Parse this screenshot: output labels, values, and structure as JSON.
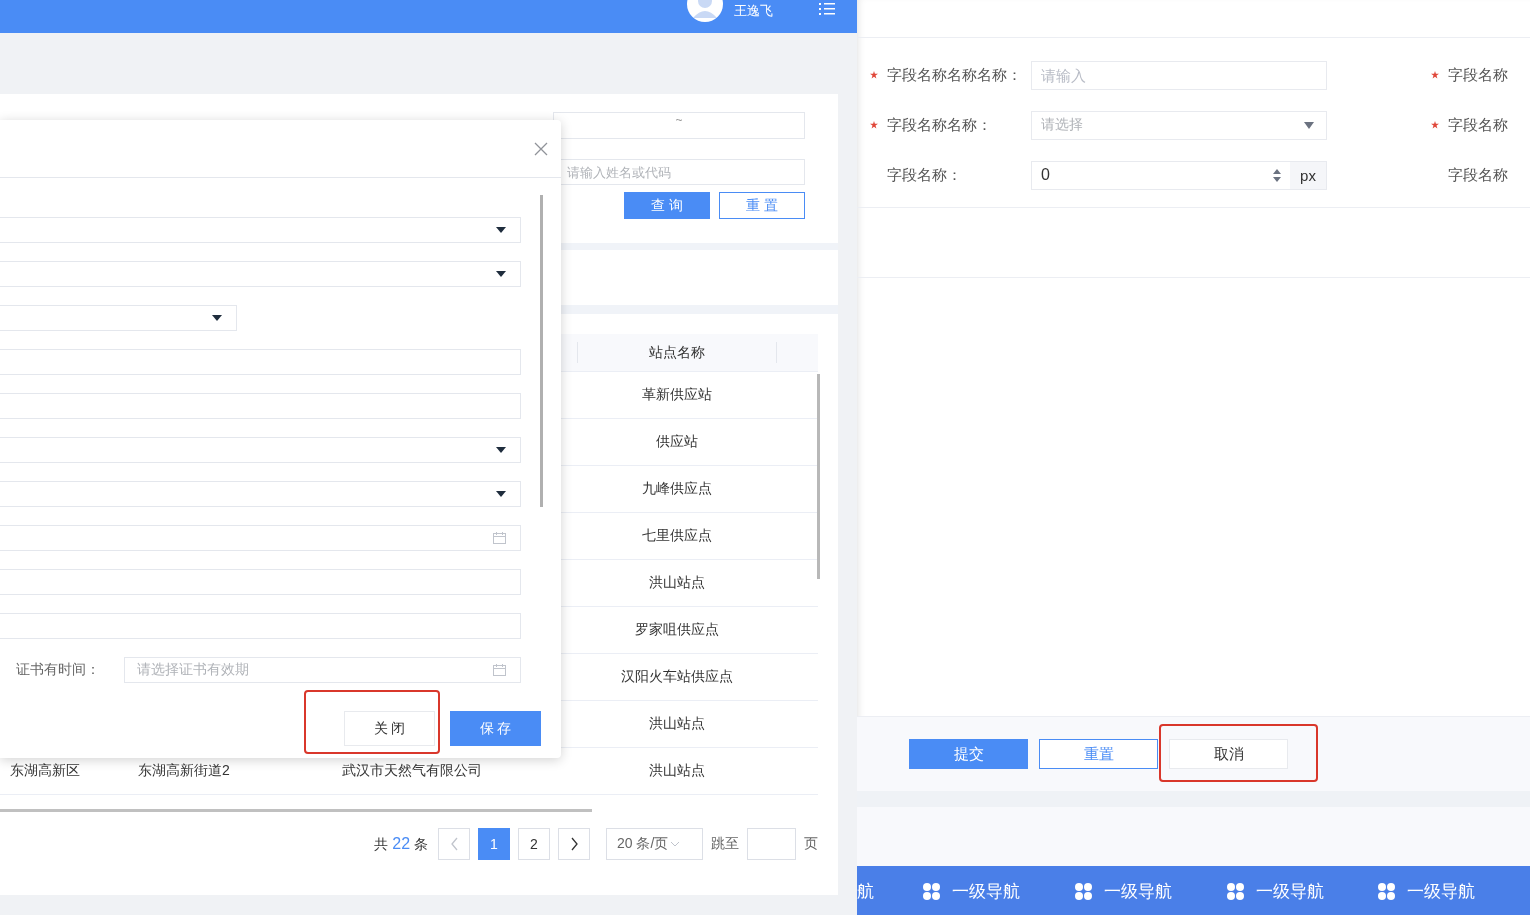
{
  "header": {
    "user_name": "王逸飞"
  },
  "filters": {
    "date_range": {
      "separator": "~"
    },
    "name_code_field": {
      "placeholder": "请输入姓名或代码"
    },
    "buttons": [
      {
        "label": "查 询",
        "kind": "primary"
      },
      {
        "label": "重 置",
        "kind": "outline"
      }
    ]
  },
  "table": {
    "columns": [
      "站点名称"
    ],
    "rows": [
      {
        "station": "革新供应站"
      },
      {
        "station": "供应站"
      },
      {
        "station": "九峰供应点"
      },
      {
        "station": "七里供应点"
      },
      {
        "station": "洪山站点"
      },
      {
        "station": "罗家咀供应点"
      },
      {
        "station": "汉阳火车站供应点"
      },
      {
        "station": "洪山站点"
      },
      {
        "district": "东湖高新区",
        "street": "东湖高新街道2",
        "company": "武汉市天然气有限公司",
        "station": "洪山站点"
      }
    ]
  },
  "pagination": {
    "total_prefix": "共",
    "total": "22",
    "total_suffix": "条",
    "pages": [
      {
        "label": "1",
        "selected": true
      },
      {
        "label": "2",
        "selected": false
      }
    ],
    "page_size": "20 条/页",
    "jump_label": "跳至",
    "page_suffix": "页"
  },
  "dialog": {
    "fields": [
      {
        "kind": "select"
      },
      {
        "kind": "select"
      },
      {
        "kind": "short-select"
      },
      {
        "kind": "input"
      },
      {
        "kind": "input"
      },
      {
        "kind": "select"
      },
      {
        "kind": "select"
      },
      {
        "kind": "date"
      },
      {
        "kind": "input"
      },
      {
        "kind": "input"
      }
    ],
    "cert_field": {
      "label": "证书有时间：",
      "placeholder": "请选择证书有效期"
    },
    "buttons": [
      {
        "label": "关 闭",
        "kind": "default",
        "highlighted": true
      },
      {
        "label": "保 存",
        "kind": "primary",
        "highlighted": false
      }
    ]
  },
  "form_panel": {
    "rows": [
      {
        "required": true,
        "label": "字段名称名称名称：",
        "control": {
          "kind": "input",
          "placeholder": "请输入"
        },
        "side_required": true,
        "side_label": "字段名称"
      },
      {
        "required": true,
        "label": "字段名称名称：",
        "control": {
          "kind": "select",
          "placeholder": "请选择"
        },
        "side_required": true,
        "side_label": "字段名称"
      },
      {
        "required": false,
        "label": "字段名称：",
        "control": {
          "kind": "number",
          "value": "0",
          "unit": "px"
        },
        "side_required": false,
        "side_label": "字段名称"
      }
    ],
    "buttons": [
      {
        "label": "提交",
        "kind": "primary",
        "highlighted": false
      },
      {
        "label": "重置",
        "kind": "outline",
        "highlighted": false
      },
      {
        "label": "取消",
        "kind": "default",
        "highlighted": true
      }
    ]
  },
  "bottom_nav": {
    "items": [
      {
        "label": "航",
        "icon": false
      },
      {
        "label": "一级导航",
        "icon": true
      },
      {
        "label": "一级导航",
        "icon": true
      },
      {
        "label": "一级导航",
        "icon": true
      },
      {
        "label": "一级导航",
        "icon": true
      }
    ]
  }
}
